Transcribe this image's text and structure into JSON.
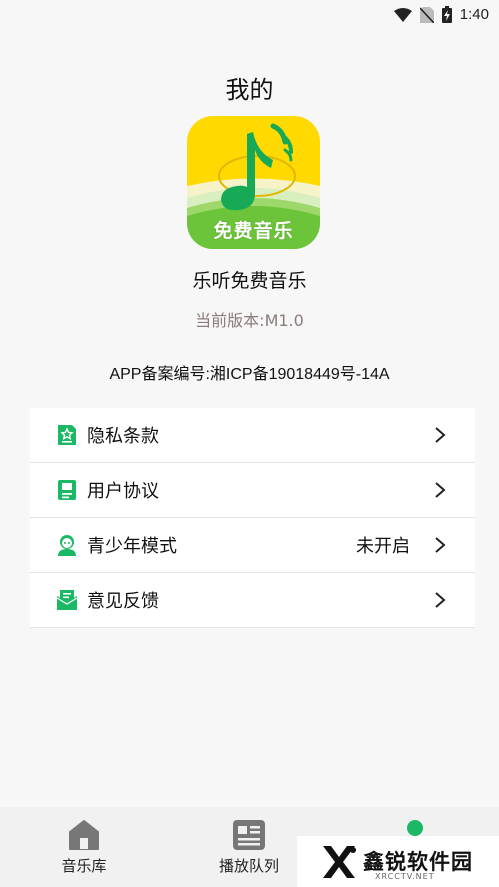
{
  "status_bar": {
    "time": "1:40"
  },
  "header": {
    "title": "我的"
  },
  "app": {
    "logo_text": "免费音乐",
    "name": "乐听免费音乐",
    "version": "当前版本:M1.0",
    "icp": "APP备案编号:湘ICP备19018449号-14A"
  },
  "menu": {
    "items": [
      {
        "label": "隐私条款",
        "value": "",
        "icon": "privacy-icon"
      },
      {
        "label": "用户协议",
        "value": "",
        "icon": "agreement-icon"
      },
      {
        "label": "青少年模式",
        "value": "未开启",
        "icon": "teen-mode-icon"
      },
      {
        "label": "意见反馈",
        "value": "",
        "icon": "feedback-icon"
      }
    ]
  },
  "bottom_nav": {
    "items": [
      {
        "label": "音乐库",
        "icon": "home-icon"
      },
      {
        "label": "播放队列",
        "icon": "playlist-icon"
      },
      {
        "label": "",
        "icon": "profile-icon"
      }
    ]
  },
  "watermark": {
    "text": "鑫锐软件园",
    "sub": "XRCCTV.NET"
  },
  "colors": {
    "accent": "#1bb866",
    "logo_bg": "#ffd900",
    "version_text": "#8c7b7b"
  }
}
